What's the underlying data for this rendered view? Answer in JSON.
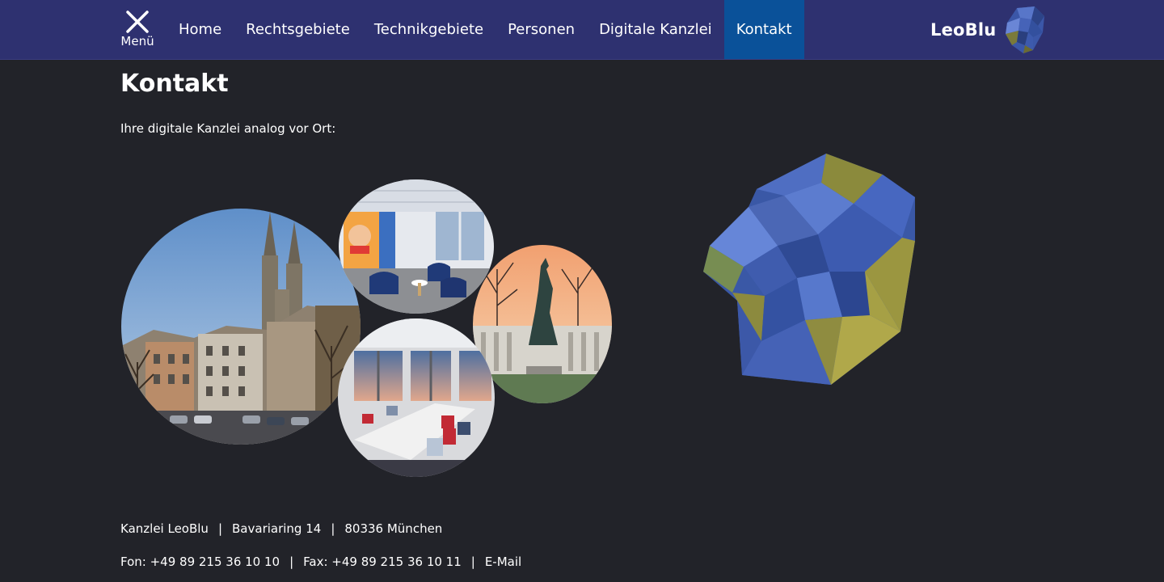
{
  "nav": {
    "menu_label": "Menü",
    "items": [
      {
        "label": "Home"
      },
      {
        "label": "Rechtsgebiete"
      },
      {
        "label": "Technikgebiete"
      },
      {
        "label": "Personen"
      },
      {
        "label": "Digitale Kanzlei"
      },
      {
        "label": "Kontakt",
        "active": true
      }
    ],
    "brand": "LeoBlu"
  },
  "main": {
    "title": "Kontakt",
    "intro": "Ihre digitale Kanzlei analog vor Ort:"
  },
  "footer": {
    "company": "Kanzlei LeoBlu",
    "street": "Bavariaring 14",
    "city": "80336 München",
    "phone": "Fon: +49 89 215 36 10 10",
    "fax": "Fax: +49 89 215 36 10 11",
    "email_label": "E-Mail",
    "separator": "|"
  },
  "colors": {
    "nav_background": "#2e3170",
    "active_tab": "#0a5199",
    "page_background": "#222329",
    "lion_blue": "#4a6fd0",
    "lion_gold": "#8a8a3a"
  },
  "icons": {
    "menu": "close-x-icon",
    "brand_logo": "lion-head-logo-icon"
  }
}
